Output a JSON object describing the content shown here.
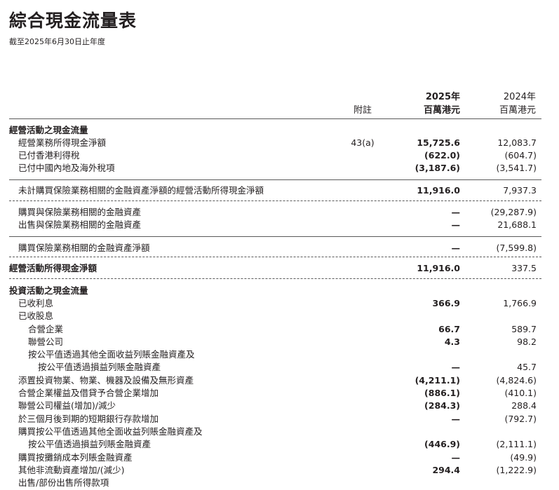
{
  "title": "綜合現金流量表",
  "subtitle": "截至2025年6月30日止年度",
  "header": {
    "note_label": "附註",
    "current_year": "2025年",
    "current_unit": "百萬港元",
    "prior_year": "2024年",
    "prior_unit": "百萬港元"
  },
  "rows": [
    {
      "label": "經營活動之現金流量",
      "note": "",
      "v2025": "",
      "v2024": ""
    },
    {
      "label": "經營業務所得現金淨額",
      "note": "43(a)",
      "v2025": "15,725.6",
      "v2024": "12,083.7"
    },
    {
      "label": "已付香港利得稅",
      "note": "",
      "v2025": "(622.0)",
      "v2024": "(604.7)"
    },
    {
      "label": "已付中國內地及海外稅項",
      "note": "",
      "v2025": "(3,187.6)",
      "v2024": "(3,541.7)"
    },
    {
      "label": "未計購買保險業務相關的金融資產淨額的經營活動所得現金淨額",
      "note": "",
      "v2025": "11,916.0",
      "v2024": "7,937.3"
    },
    {
      "label": "購買與保險業務相關的金融資產",
      "note": "",
      "v2025": "—",
      "v2024": "(29,287.9)"
    },
    {
      "label": "出售與保險業務相關的金融資產",
      "note": "",
      "v2025": "—",
      "v2024": "21,688.1"
    },
    {
      "label": "購買保險業務相關的金融資產淨額",
      "note": "",
      "v2025": "—",
      "v2024": "(7,599.8)"
    },
    {
      "label": "經營活動所得現金淨額",
      "note": "",
      "v2025": "11,916.0",
      "v2024": "337.5"
    },
    {
      "label": "投資活動之現金流量",
      "note": "",
      "v2025": "",
      "v2024": ""
    },
    {
      "label": "已收利息",
      "note": "",
      "v2025": "366.9",
      "v2024": "1,766.9"
    },
    {
      "label": "已收股息",
      "note": "",
      "v2025": "",
      "v2024": ""
    },
    {
      "label": "合營企業",
      "note": "",
      "v2025": "66.7",
      "v2024": "589.7"
    },
    {
      "label": "聯營公司",
      "note": "",
      "v2025": "4.3",
      "v2024": "98.2"
    },
    {
      "label": "按公平值透過其他全面收益列賬金融資產及",
      "note": "",
      "v2025": "",
      "v2024": ""
    },
    {
      "label": "按公平值透過損益列賬金融資產",
      "note": "",
      "v2025": "—",
      "v2024": "45.7"
    },
    {
      "label": "添置投資物業、物業、機器及設備及無形資產",
      "note": "",
      "v2025": "(4,211.1)",
      "v2024": "(4,824.6)"
    },
    {
      "label": "合營企業權益及借貸予合營企業增加",
      "note": "",
      "v2025": "(886.1)",
      "v2024": "(410.1)"
    },
    {
      "label": "聯營公司權益(增加)/減少",
      "note": "",
      "v2025": "(284.3)",
      "v2024": "288.4"
    },
    {
      "label": "於三個月後到期的短期銀行存款增加",
      "note": "",
      "v2025": "—",
      "v2024": "(792.7)"
    },
    {
      "label": "購買按公平值透過其他全面收益列賬金融資產及",
      "note": "",
      "v2025": "",
      "v2024": ""
    },
    {
      "label": "按公平值透過損益列賬金融資產",
      "note": "",
      "v2025": "(446.9)",
      "v2024": "(2,111.1)"
    },
    {
      "label": "購買按攤銷成本列賬金融資產",
      "note": "",
      "v2025": "—",
      "v2024": "(49.9)"
    },
    {
      "label": "其他非流動資產增加/(減少)",
      "note": "",
      "v2025": "294.4",
      "v2024": "(1,222.9)"
    },
    {
      "label": "出售/部份出售所得款項",
      "note": "",
      "v2025": "",
      "v2024": ""
    }
  ]
}
